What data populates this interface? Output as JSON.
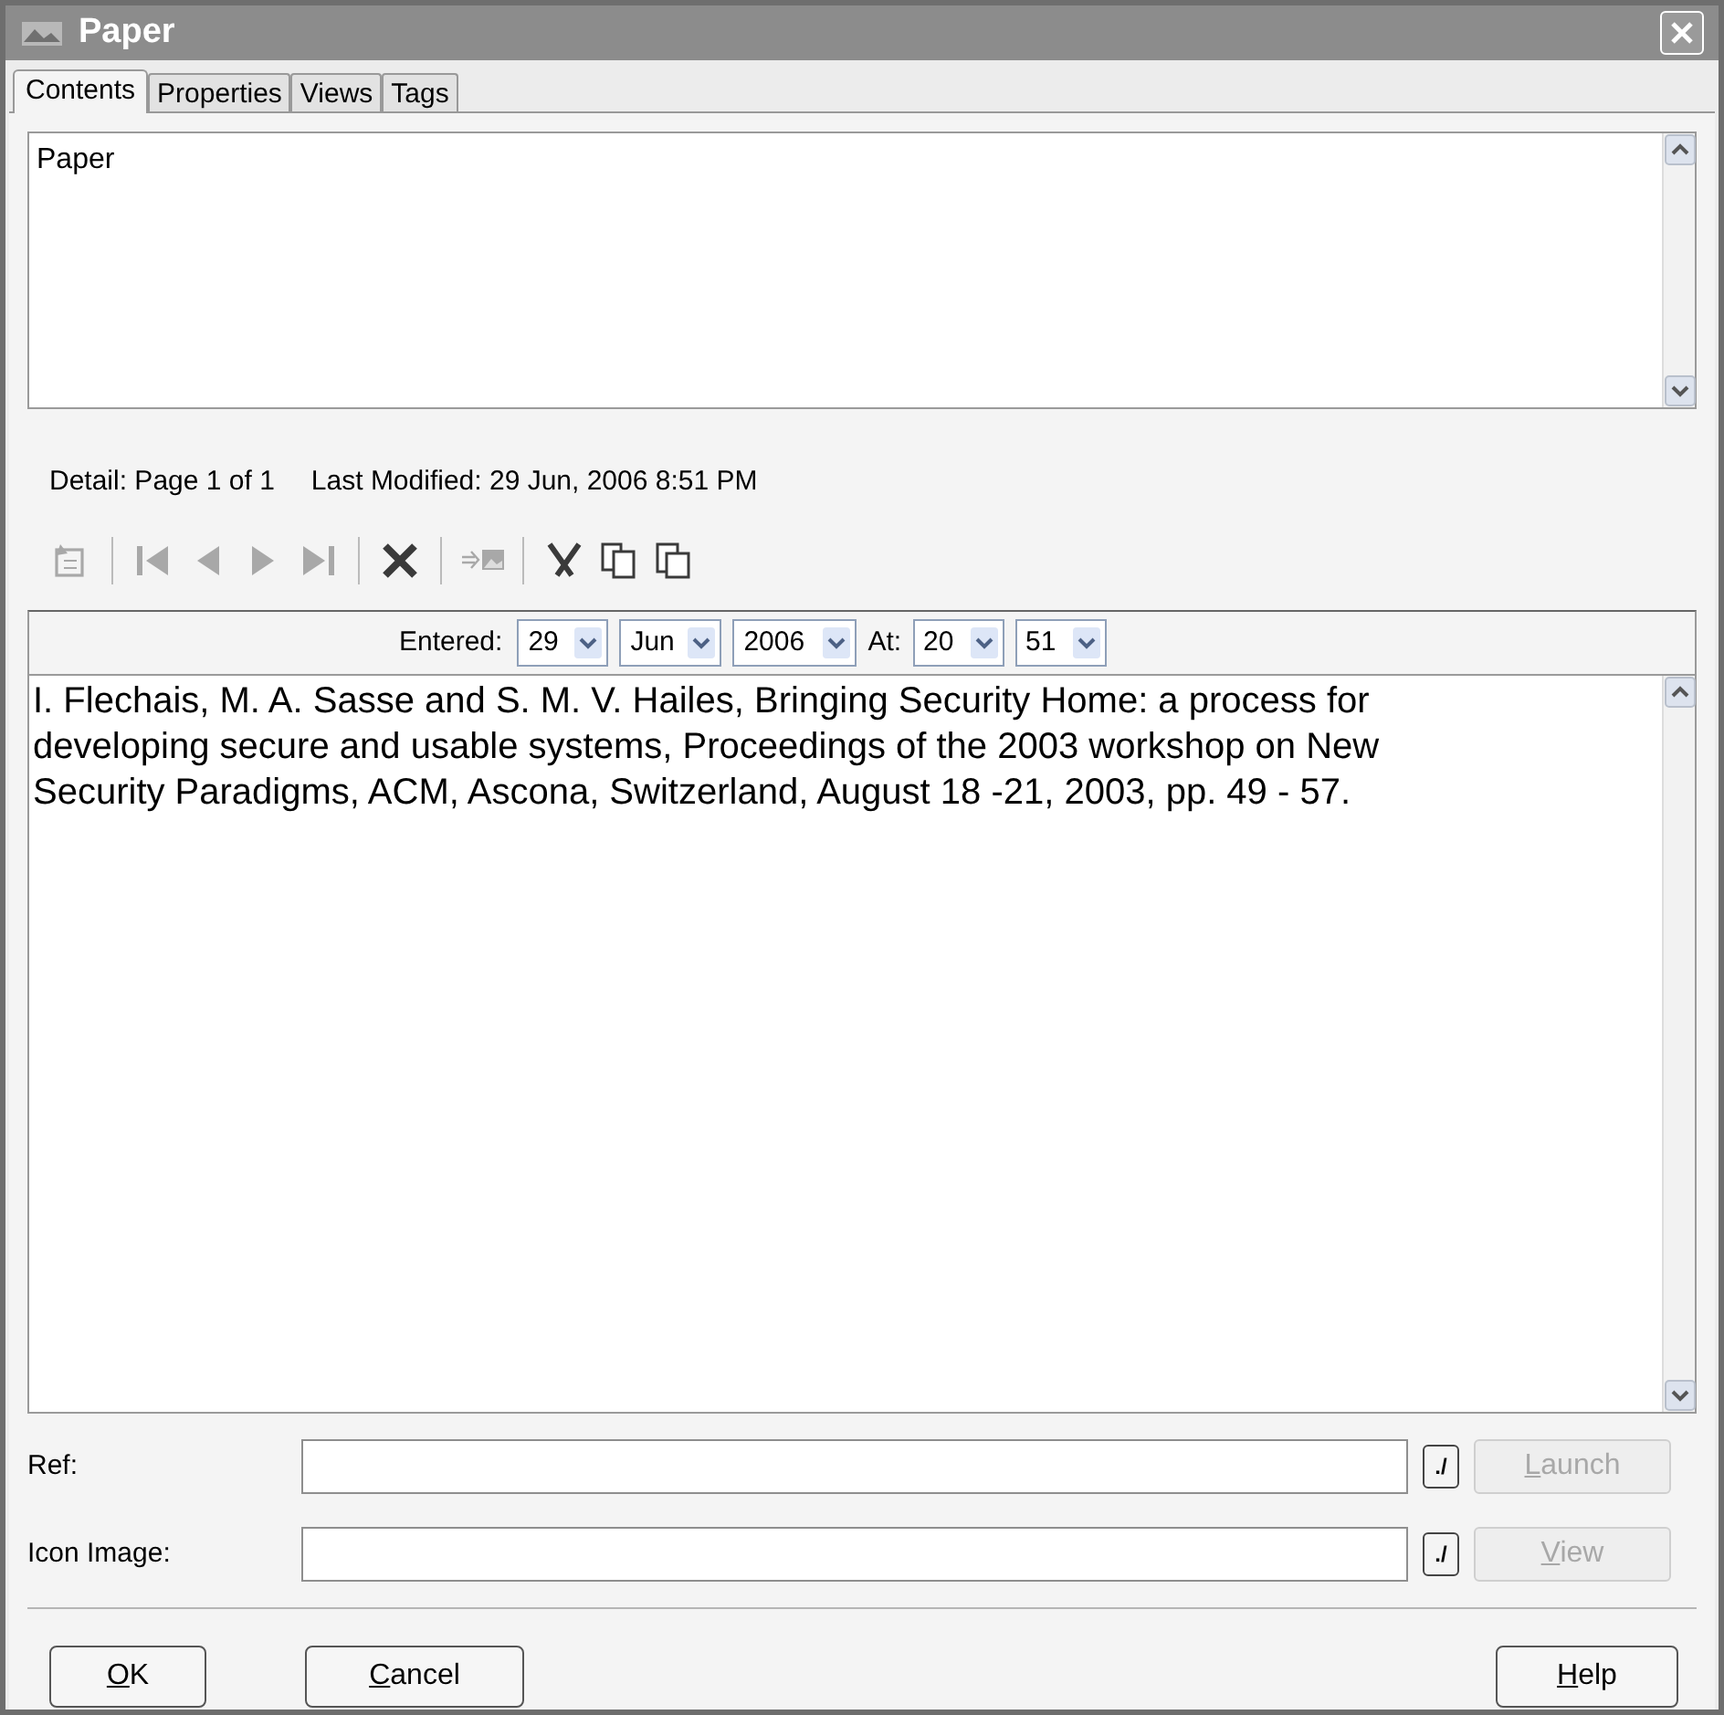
{
  "window": {
    "title": "Paper"
  },
  "tabs": [
    {
      "label": "Contents",
      "selected": true
    },
    {
      "label": "Properties",
      "selected": false
    },
    {
      "label": "Views",
      "selected": false
    },
    {
      "label": "Tags",
      "selected": false
    }
  ],
  "title_field": {
    "value": "Paper"
  },
  "detail": "Detail: Page 1 of 1",
  "last_modified": "Last Modified: 29 Jun, 2006 8:51 PM",
  "toolbar": [
    {
      "kind": "new",
      "disabled": true
    },
    {
      "kind": "separator"
    },
    {
      "kind": "first",
      "disabled": true
    },
    {
      "kind": "prev",
      "disabled": true
    },
    {
      "kind": "next",
      "disabled": true
    },
    {
      "kind": "last",
      "disabled": true
    },
    {
      "kind": "separator"
    },
    {
      "kind": "delete",
      "disabled": false
    },
    {
      "kind": "separator"
    },
    {
      "kind": "to-image",
      "disabled": true
    },
    {
      "kind": "separator"
    },
    {
      "kind": "cut",
      "disabled": false
    },
    {
      "kind": "copy",
      "disabled": false
    },
    {
      "kind": "paste",
      "disabled": false
    }
  ],
  "entered": {
    "label": "Entered:",
    "day": "29",
    "month": "Jun",
    "year": "2006",
    "at_label": "At:",
    "hour": "20",
    "minute": "51"
  },
  "body": {
    "value": "I. Flechais, M. A. Sasse and S. M. V. Hailes, Bringing Security Home: a process for developing secure and usable systems, Proceedings of the 2003 workshop on New Security Paradigms, ACM, Ascona, Switzerland, August 18 -21, 2003, pp. 49 - 57."
  },
  "fields": [
    {
      "label": "Ref:",
      "browse": "./",
      "button": "Launch",
      "button_disabled": true
    },
    {
      "label": "Icon Image:",
      "browse": "./",
      "button": "View",
      "button_disabled": true
    }
  ],
  "buttons": [
    {
      "label": "OK",
      "mnemonic": true
    },
    {
      "label": "Cancel",
      "mnemonic": true
    },
    {
      "label": "Help",
      "mnemonic": true
    }
  ]
}
